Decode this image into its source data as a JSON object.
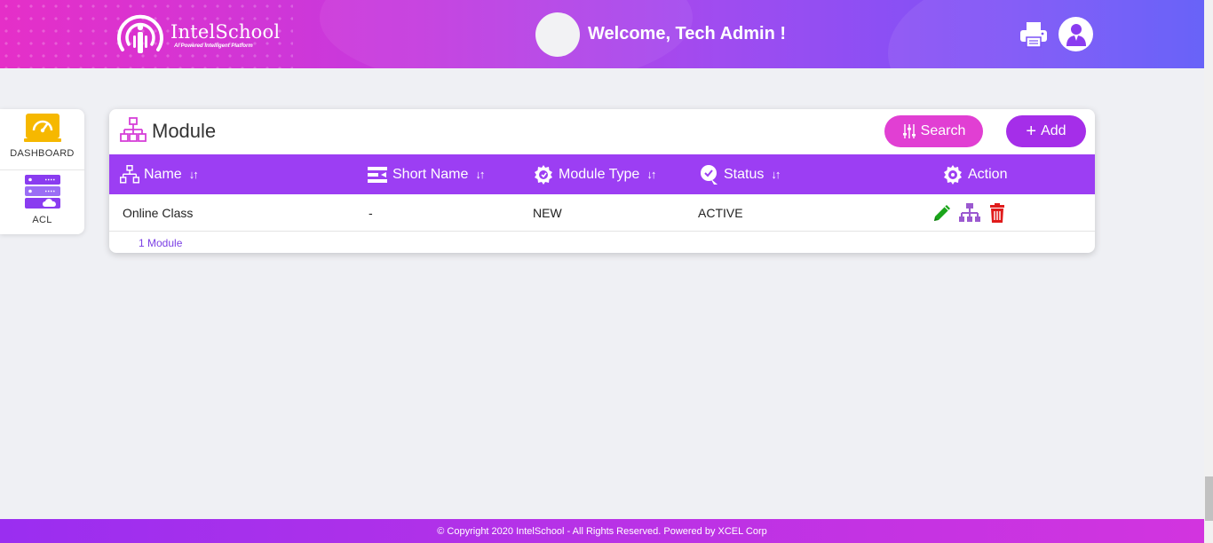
{
  "header": {
    "brand_name": "IntelSchool",
    "brand_tagline": "AI Powered Intelligent Platform",
    "welcome_text": "Welcome, Tech Admin !"
  },
  "sidebar": {
    "items": [
      {
        "label": "DASHBOARD",
        "icon": "dashboard-icon"
      },
      {
        "label": "ACL",
        "icon": "server-cloud-icon"
      }
    ]
  },
  "module": {
    "title": "Module",
    "search_label": "Search",
    "add_label": "Add",
    "columns": [
      {
        "label": "Name",
        "icon": "hierarchy-icon"
      },
      {
        "label": "Short Name",
        "icon": "short-name-icon"
      },
      {
        "label": "Module Type",
        "icon": "gear-icon"
      },
      {
        "label": "Status",
        "icon": "status-icon"
      },
      {
        "label": "Action",
        "icon": "gear-icon"
      }
    ],
    "sort_glyph": "↓↑",
    "rows": [
      {
        "name": "Online Class",
        "short_name": "-",
        "module_type": "NEW",
        "status": "ACTIVE"
      }
    ],
    "count_text": "1 Module"
  },
  "colors": {
    "accent_purple": "#9c3ef3",
    "search_pink": "#e13fd3",
    "edit_green": "#1aa51a",
    "delete_red": "#e01b1b"
  },
  "footer": {
    "copyright": "© Copyright 2020 IntelSchool - All Rights Reserved. Powered by XCEL Corp"
  }
}
